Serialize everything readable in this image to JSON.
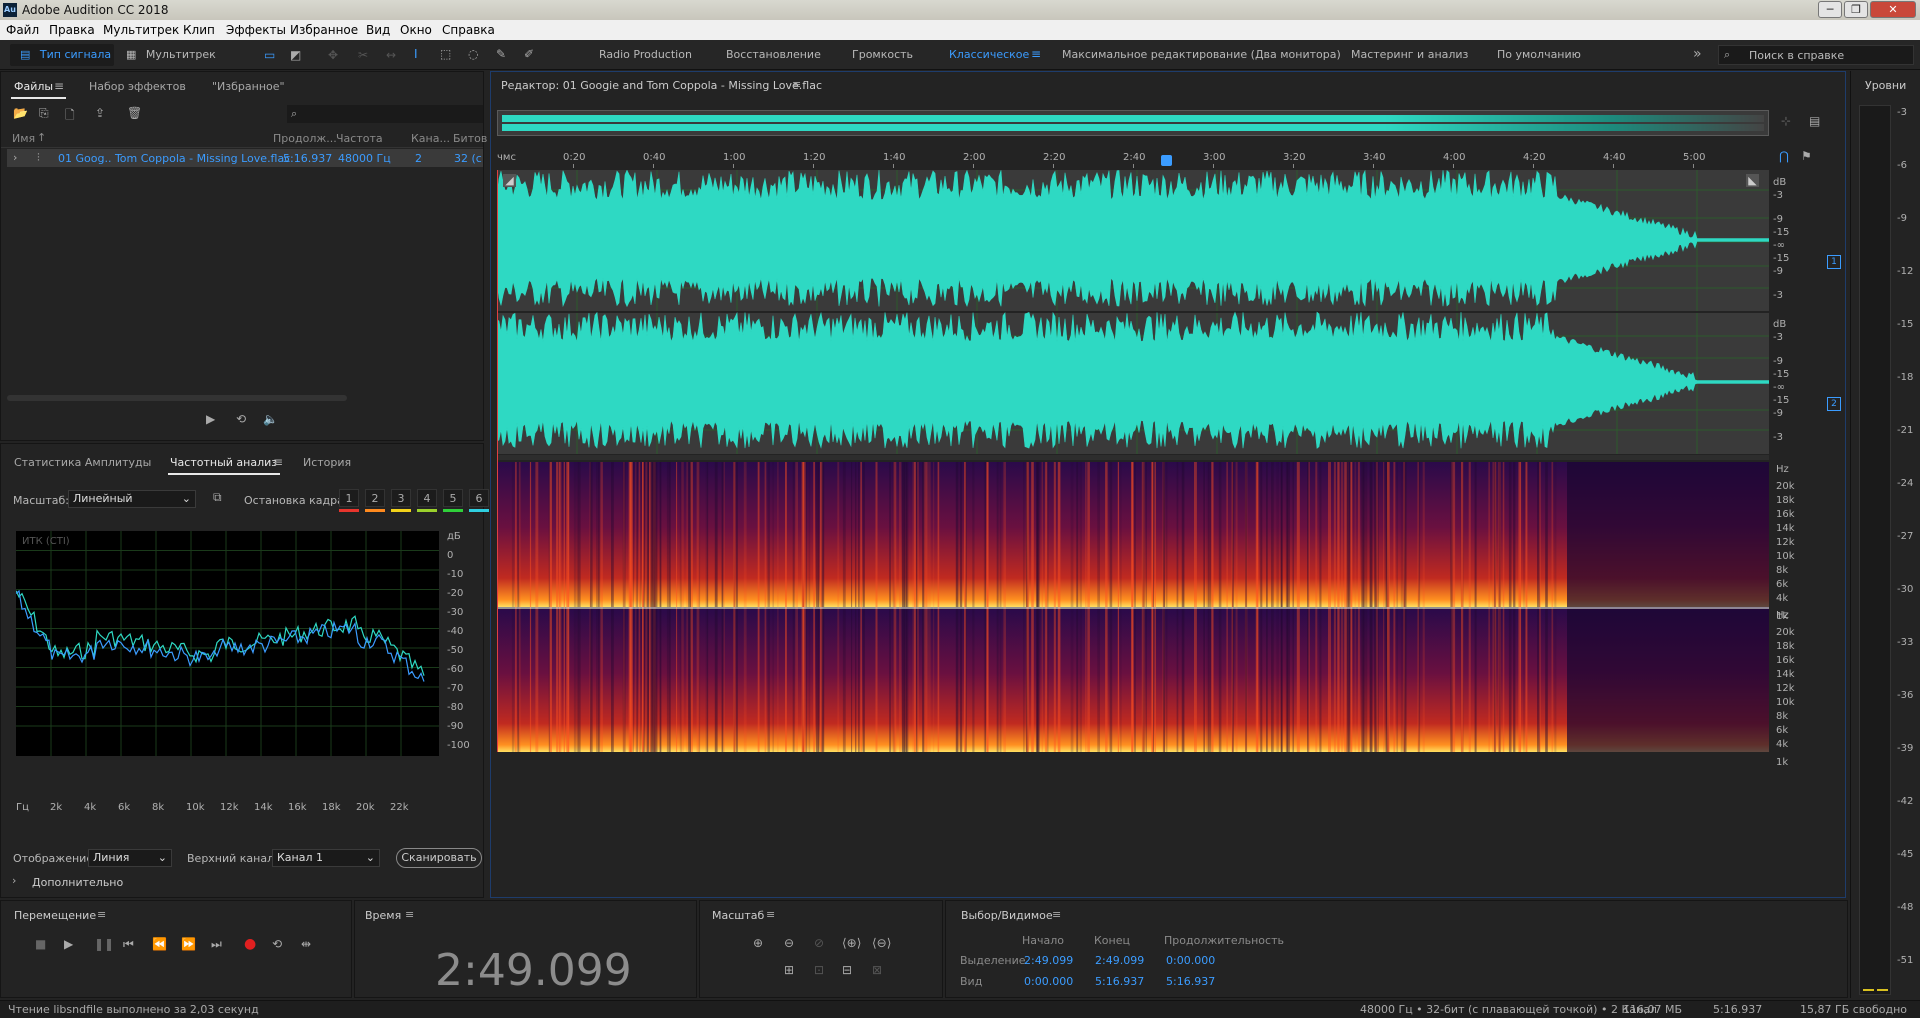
{
  "app": {
    "title": "Adobe Audition CC 2018",
    "logo": "Au"
  },
  "menu": [
    "Файл",
    "Правка",
    "Мультитрек",
    "Клип",
    "Эффекты",
    "Избранное",
    "Вид",
    "Окно",
    "Справка"
  ],
  "toolbar": {
    "mode_waveform": "Тип сигнала",
    "mode_multitrack": "Мультитрек",
    "workspaces": [
      "Radio Production",
      "Восстановление",
      "Громкость",
      "Классическое",
      "Максимальное редактирование (Два монитора)",
      "Мастеринг и анализ",
      "По умолчанию"
    ],
    "active_workspace": "Классическое",
    "search_placeholder": "Поиск в справке"
  },
  "files_panel": {
    "tabs": [
      "Файлы",
      "Набор эффектов",
      "\"Избранное\""
    ],
    "columns": [
      "Имя",
      "Продолж...",
      "Частота",
      "Кана...",
      "Битов"
    ],
    "rows": [
      {
        "name": "01 Goog.. Tom Coppola - Missing Love.flac",
        "duration": "5:16.937",
        "rate": "48000 Гц",
        "channels": "2",
        "bits": "32 (с"
      }
    ]
  },
  "analysis_panel": {
    "tabs": [
      "Статистика Амплитуды",
      "Частотный анализ",
      "История"
    ],
    "scale_label": "Масштаб:",
    "scale_value": "Линейный",
    "freeze_label": "Остановка кадра:",
    "freeze_slots": [
      "1",
      "2",
      "3",
      "4",
      "5",
      "6"
    ],
    "freeze_colors": [
      "#e8352d",
      "#ff8a1e",
      "#f2d21a",
      "#9bd12c",
      "#2fd03a",
      "#2fcfe0"
    ],
    "chart_label": "ИТК (СТI)",
    "db_ticks": [
      "дБ",
      "0",
      "-10",
      "-20",
      "-30",
      "-40",
      "-50",
      "-60",
      "-70",
      "-80",
      "-90",
      "-100"
    ],
    "hz_ticks": [
      "Гц",
      "2k",
      "4k",
      "6k",
      "8k",
      "10k",
      "12k",
      "14k",
      "16k",
      "18k",
      "20k",
      "22k"
    ],
    "display_label": "Отображение:",
    "display_value": "Линия",
    "channel_label": "Верхний канал:",
    "channel_value": "Канал 1",
    "scan_button": "Сканировать",
    "advanced": "Дополнительно"
  },
  "editor": {
    "tab_title": "Редактор: 01 Googie and Tom Coppola - Missing Love.flac",
    "ruler_unit": "чмс",
    "ruler_ticks": [
      "0:20",
      "0:40",
      "1:00",
      "1:20",
      "1:40",
      "2:00",
      "2:20",
      "2:40",
      "3:00",
      "3:20",
      "3:40",
      "4:00",
      "4:20",
      "4:40",
      "5:00"
    ],
    "db_scale": [
      "dB",
      "-3",
      "-9",
      "-15",
      "-∞",
      "-15",
      "-9",
      "-3"
    ],
    "hz_scale": [
      "Hz",
      "20k",
      "18k",
      "16k",
      "14k",
      "12k",
      "10k",
      "8k",
      "6k",
      "4k",
      "1k"
    ],
    "channel_badges": [
      "1",
      "2"
    ]
  },
  "levels": {
    "title": "Уровни",
    "ticks": [
      "-3",
      "-6",
      "-9",
      "-12",
      "-15",
      "-18",
      "-21",
      "-24",
      "-27",
      "-30",
      "-33",
      "-36",
      "-39",
      "-42",
      "-45",
      "-48",
      "-51"
    ]
  },
  "transport": {
    "title": "Перемещение"
  },
  "time": {
    "title": "Время",
    "value": "2:49.099"
  },
  "zoom": {
    "title": "Масштаб"
  },
  "selection": {
    "title": "Выбор/Видимое",
    "col_start": "Начало",
    "col_end": "Конец",
    "col_duration": "Продолжительность",
    "rows": [
      {
        "label": "Выделение",
        "start": "2:49.099",
        "end": "2:49.099",
        "duration": "0:00.000"
      },
      {
        "label": "Вид",
        "start": "0:00.000",
        "end": "5:16.937",
        "duration": "5:16.937"
      }
    ]
  },
  "status": {
    "left": "Чтение libsndfile выполнено за 2,03 секунд",
    "format": "48000 Гц • 32-бит (с плавающей точкой) • 2 Канал",
    "size": "116,07 МБ",
    "duration": "5:16.937",
    "free": "15,87 ГБ свободно"
  },
  "colors": {
    "accent": "#3b9cff",
    "waveform": "#2ed9c3",
    "playhead": "#e04040"
  }
}
